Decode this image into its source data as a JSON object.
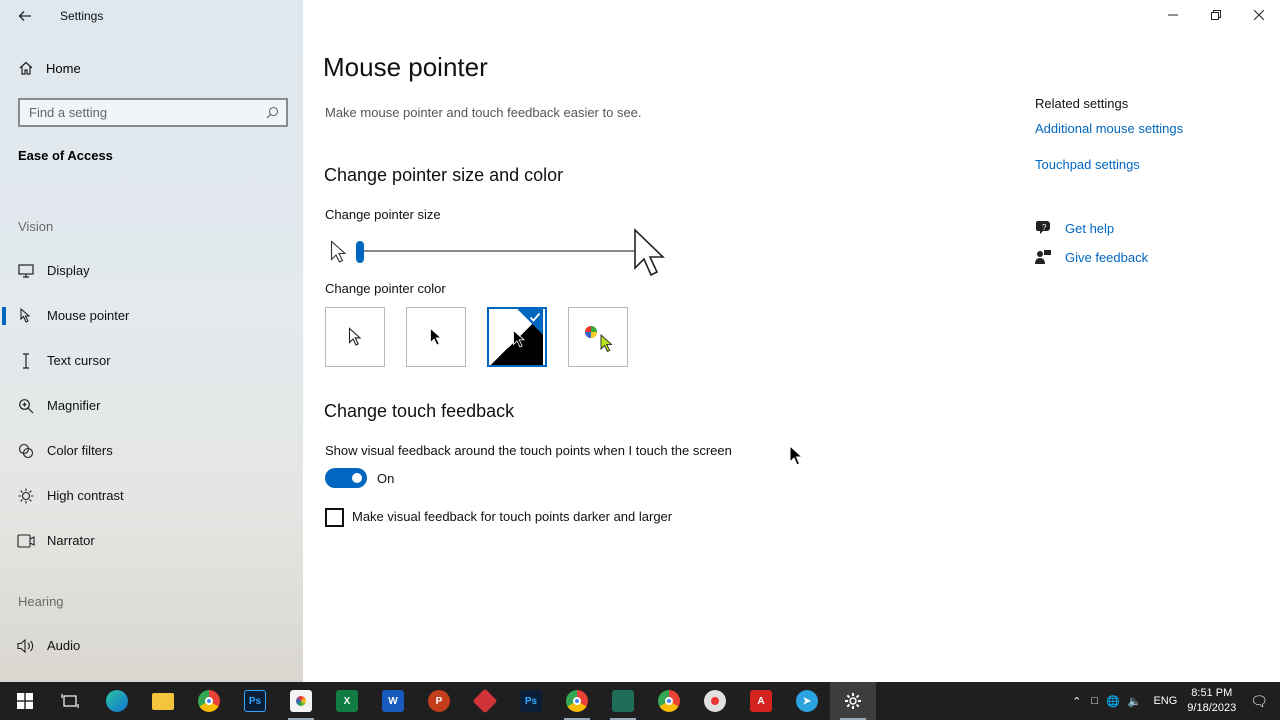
{
  "app": {
    "title": "Settings"
  },
  "sidebar": {
    "home_label": "Home",
    "search_placeholder": "Find a setting",
    "section_title": "Ease of Access",
    "groups": [
      {
        "label": "Vision"
      },
      {
        "label": "Hearing"
      }
    ],
    "items": [
      {
        "label": "Display",
        "icon": "display-icon"
      },
      {
        "label": "Mouse pointer",
        "icon": "mouse-pointer-icon",
        "active": true
      },
      {
        "label": "Text cursor",
        "icon": "text-cursor-icon"
      },
      {
        "label": "Magnifier",
        "icon": "magnifier-icon"
      },
      {
        "label": "Color filters",
        "icon": "color-filters-icon"
      },
      {
        "label": "High contrast",
        "icon": "high-contrast-icon"
      },
      {
        "label": "Narrator",
        "icon": "narrator-icon"
      },
      {
        "label": "Audio",
        "icon": "audio-icon"
      }
    ]
  },
  "main": {
    "title": "Mouse pointer",
    "subtitle": "Make mouse pointer and touch feedback easier to see.",
    "size_color": {
      "heading": "Change pointer size and color",
      "size_label": "Change pointer size",
      "size_value": 1,
      "color_label": "Change pointer color",
      "color_options": [
        "white",
        "black",
        "inverted",
        "custom"
      ],
      "selected_color": "inverted"
    },
    "touch": {
      "heading": "Change touch feedback",
      "toggle_label": "Show visual feedback around the touch points when I touch the screen",
      "toggle_state": "On",
      "checkbox_label": "Make visual feedback for touch points darker and larger",
      "checkbox_checked": false
    }
  },
  "related": {
    "title": "Related settings",
    "links": [
      "Additional mouse settings",
      "Touchpad settings"
    ],
    "get_help": "Get help",
    "give_feedback": "Give feedback"
  },
  "taskbar": {
    "lang": "ENG",
    "time": "8:51 PM",
    "date": "9/18/2023",
    "apps": [
      "start",
      "task-view",
      "edge",
      "file-explorer",
      "chrome",
      "photoshop",
      "paint",
      "excel",
      "word",
      "powerpoint",
      "app-red",
      "photoshop-2",
      "chrome-2",
      "app-green",
      "chrome-3",
      "snipping",
      "acrobat",
      "telegram",
      "settings"
    ]
  },
  "colors": {
    "accent": "#0067c0",
    "link": "#0067c0",
    "taskbar": "#1f1f1f"
  }
}
